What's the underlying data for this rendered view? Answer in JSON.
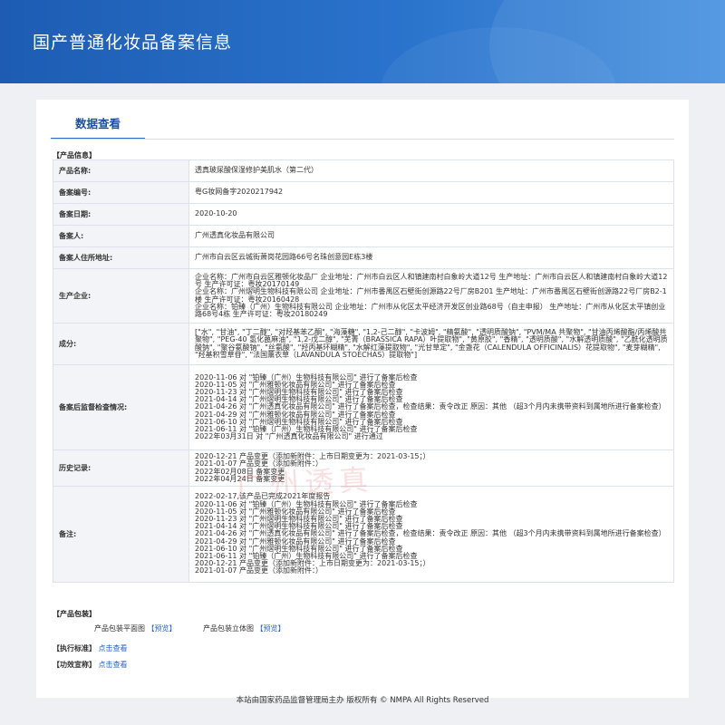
{
  "banner": {
    "title": "国产普通化妆品备案信息"
  },
  "tab": {
    "label": "数据查看"
  },
  "product_section": {
    "title": "【产品信息】"
  },
  "rows": [
    {
      "label": "产品名称:",
      "value": "透真玻尿酸保湿修护美肌水（第二代）"
    },
    {
      "label": "备案编号:",
      "value": "粤G妆网备字2020217942"
    },
    {
      "label": "备案日期:",
      "value": "2020-10-20"
    },
    {
      "label": "备案人:",
      "value": "广州透真化妆品有限公司"
    },
    {
      "label": "备案人住所地址:",
      "value": "广州市白云区云城街萧岗花园路66号名珠创意园E栋3楼"
    },
    {
      "label": "生产企业:",
      "value": "企业名称：广州市白云区雅顿化妆品厂 企业地址：广州市白云区人和镇建南村白象岭大道12号 生产地址：广州市白云区人和镇建南村白象岭大道12号 生产许可证：粤妆20170149\n企业名称：广州熠明生物科技有限公司 企业地址：广州市番禺区石壁街创源路22号厂房B201 生产地址：广州市番禺区石壁街创源路22号厂房B2-1楼 生产许可证：粤妆20160428\n企业名称：铂臻（广州）生物科技有限公司 企业地址：广州市从化区太平经济开发区创业路68号（自主申报） 生产地址：广州市从化区太平镇创业路68号4栋 生产许可证：粤妆20180249"
    },
    {
      "label": "成分:",
      "value": "[\"水\", \"甘油\", \"丁二醇\", \"对羟基苯乙酮\", \"海藻糖\", \"1,2-己二醇\", \"卡波姆\", \"精氨酸\", \"透明质酸钠\", \"PVM/MA 共聚物\", \"甘油丙烯酸酯/丙烯酸共聚物\", \"PEG-40 氢化蓖麻油\", \"1,2-戊二醇\", \"芜菁（BRASSICA RAPA）叶提取物\", \"黄原胶\", \"香精\", \"透明质酸\", \"水解透明质酸\", \"乙酰化透明质酸钠\", \"聚谷氨酸钠\", \"丝氨酸\", \"羟丙基环糊精\", \"水解红藻提取物\", \"光甘草定\", \"金盏花（CALENDULA OFFICINALIS）花提取物\", \"麦芽糊精\", \"羟基积雪草苷\", \"法国薰衣草（LAVANDULA STOECHAS）提取物\"]"
    },
    {
      "label": "备案后监督检查情况:",
      "value": "2020-11-06 对 \"铂臻（广州）生物科技有限公司\" 进行了备案后检查\n2020-11-05 对 \"广州雅顿化妆品有限公司\" 进行了备案后检查\n2020-11-23 对 \"广州熠明生物科技有限公司\" 进行了备案后检查\n2021-04-14 对 \"广州熠明生物科技有限公司\" 进行了备案后检查\n2021-04-26 对 \"广州透真化妆品有限公司\" 进行了备案后检查，检查结果：责令改正 原因：其他 （超3个月内未携带资料到属地所进行备案检查）\n2021-04-29 对 \"广州雅顿化妆品有限公司\" 进行了备案后检查\n2021-06-10 对 \"广州熠明生物科技有限公司\" 进行了备案后检查\n2021-06-11 对 \"铂臻（广州）生物科技有限公司\" 进行了备案后检查\n2022年03月31日 对 \"广州透真化妆品有限公司\" 进行通过"
    },
    {
      "label": "历史记录:",
      "value": "2020-12-21 产品变更（添加新附件：上市日期变更为：2021-03-15；）\n2021-01-07 产品变更（添加新附件：）\n2022年02月08日 备案变更\n2022年04月24日 备案变更"
    },
    {
      "label": "备注:",
      "value": "2022-02-17,该产品已完成2021年度报告\n2020-11-06 对 \"铂臻（广州）生物科技有限公司\" 进行了备案后检查\n2020-11-05 对 \"广州雅顿化妆品有限公司\" 进行了备案后检查\n2020-11-23 对 \"广州熠明生物科技有限公司\" 进行了备案后检查\n2021-04-14 对 \"广州熠明生物科技有限公司\" 进行了备案后检查\n2021-04-26 对 \"广州透真化妆品有限公司\" 进行了备案后检查，检查结果：责令改正 原因：其他 （超3个月内未携带资料到属地所进行备案检查）\n2021-04-29 对 \"广州雅顿化妆品有限公司\" 进行了备案后检查\n2021-06-10 对 \"广州熠明生物科技有限公司\" 进行了备案后检查\n2021-06-11 对 \"铂臻（广州）生物科技有限公司\" 进行了备案后检查\n2020-12-21 产品变更（添加新附件：上市日期变更为：2021-03-15；）\n2021-01-07 产品变更（添加新附件：）"
    }
  ],
  "packaging": {
    "title": "【产品包装】",
    "flat_label": "产品包装平面图",
    "flat_link": "【预览】",
    "solid_label": "产品包装立体图",
    "solid_link": "【预览】"
  },
  "standard": {
    "title": "【执行标准】",
    "link": "点击查看"
  },
  "claims": {
    "title": "【功效宣称】",
    "link": "点击查看"
  },
  "watermark": "广州透真",
  "footer": {
    "text": "本站由国家药品监督管理局主办 版权所有 © NMPA All Rights Reserved"
  }
}
